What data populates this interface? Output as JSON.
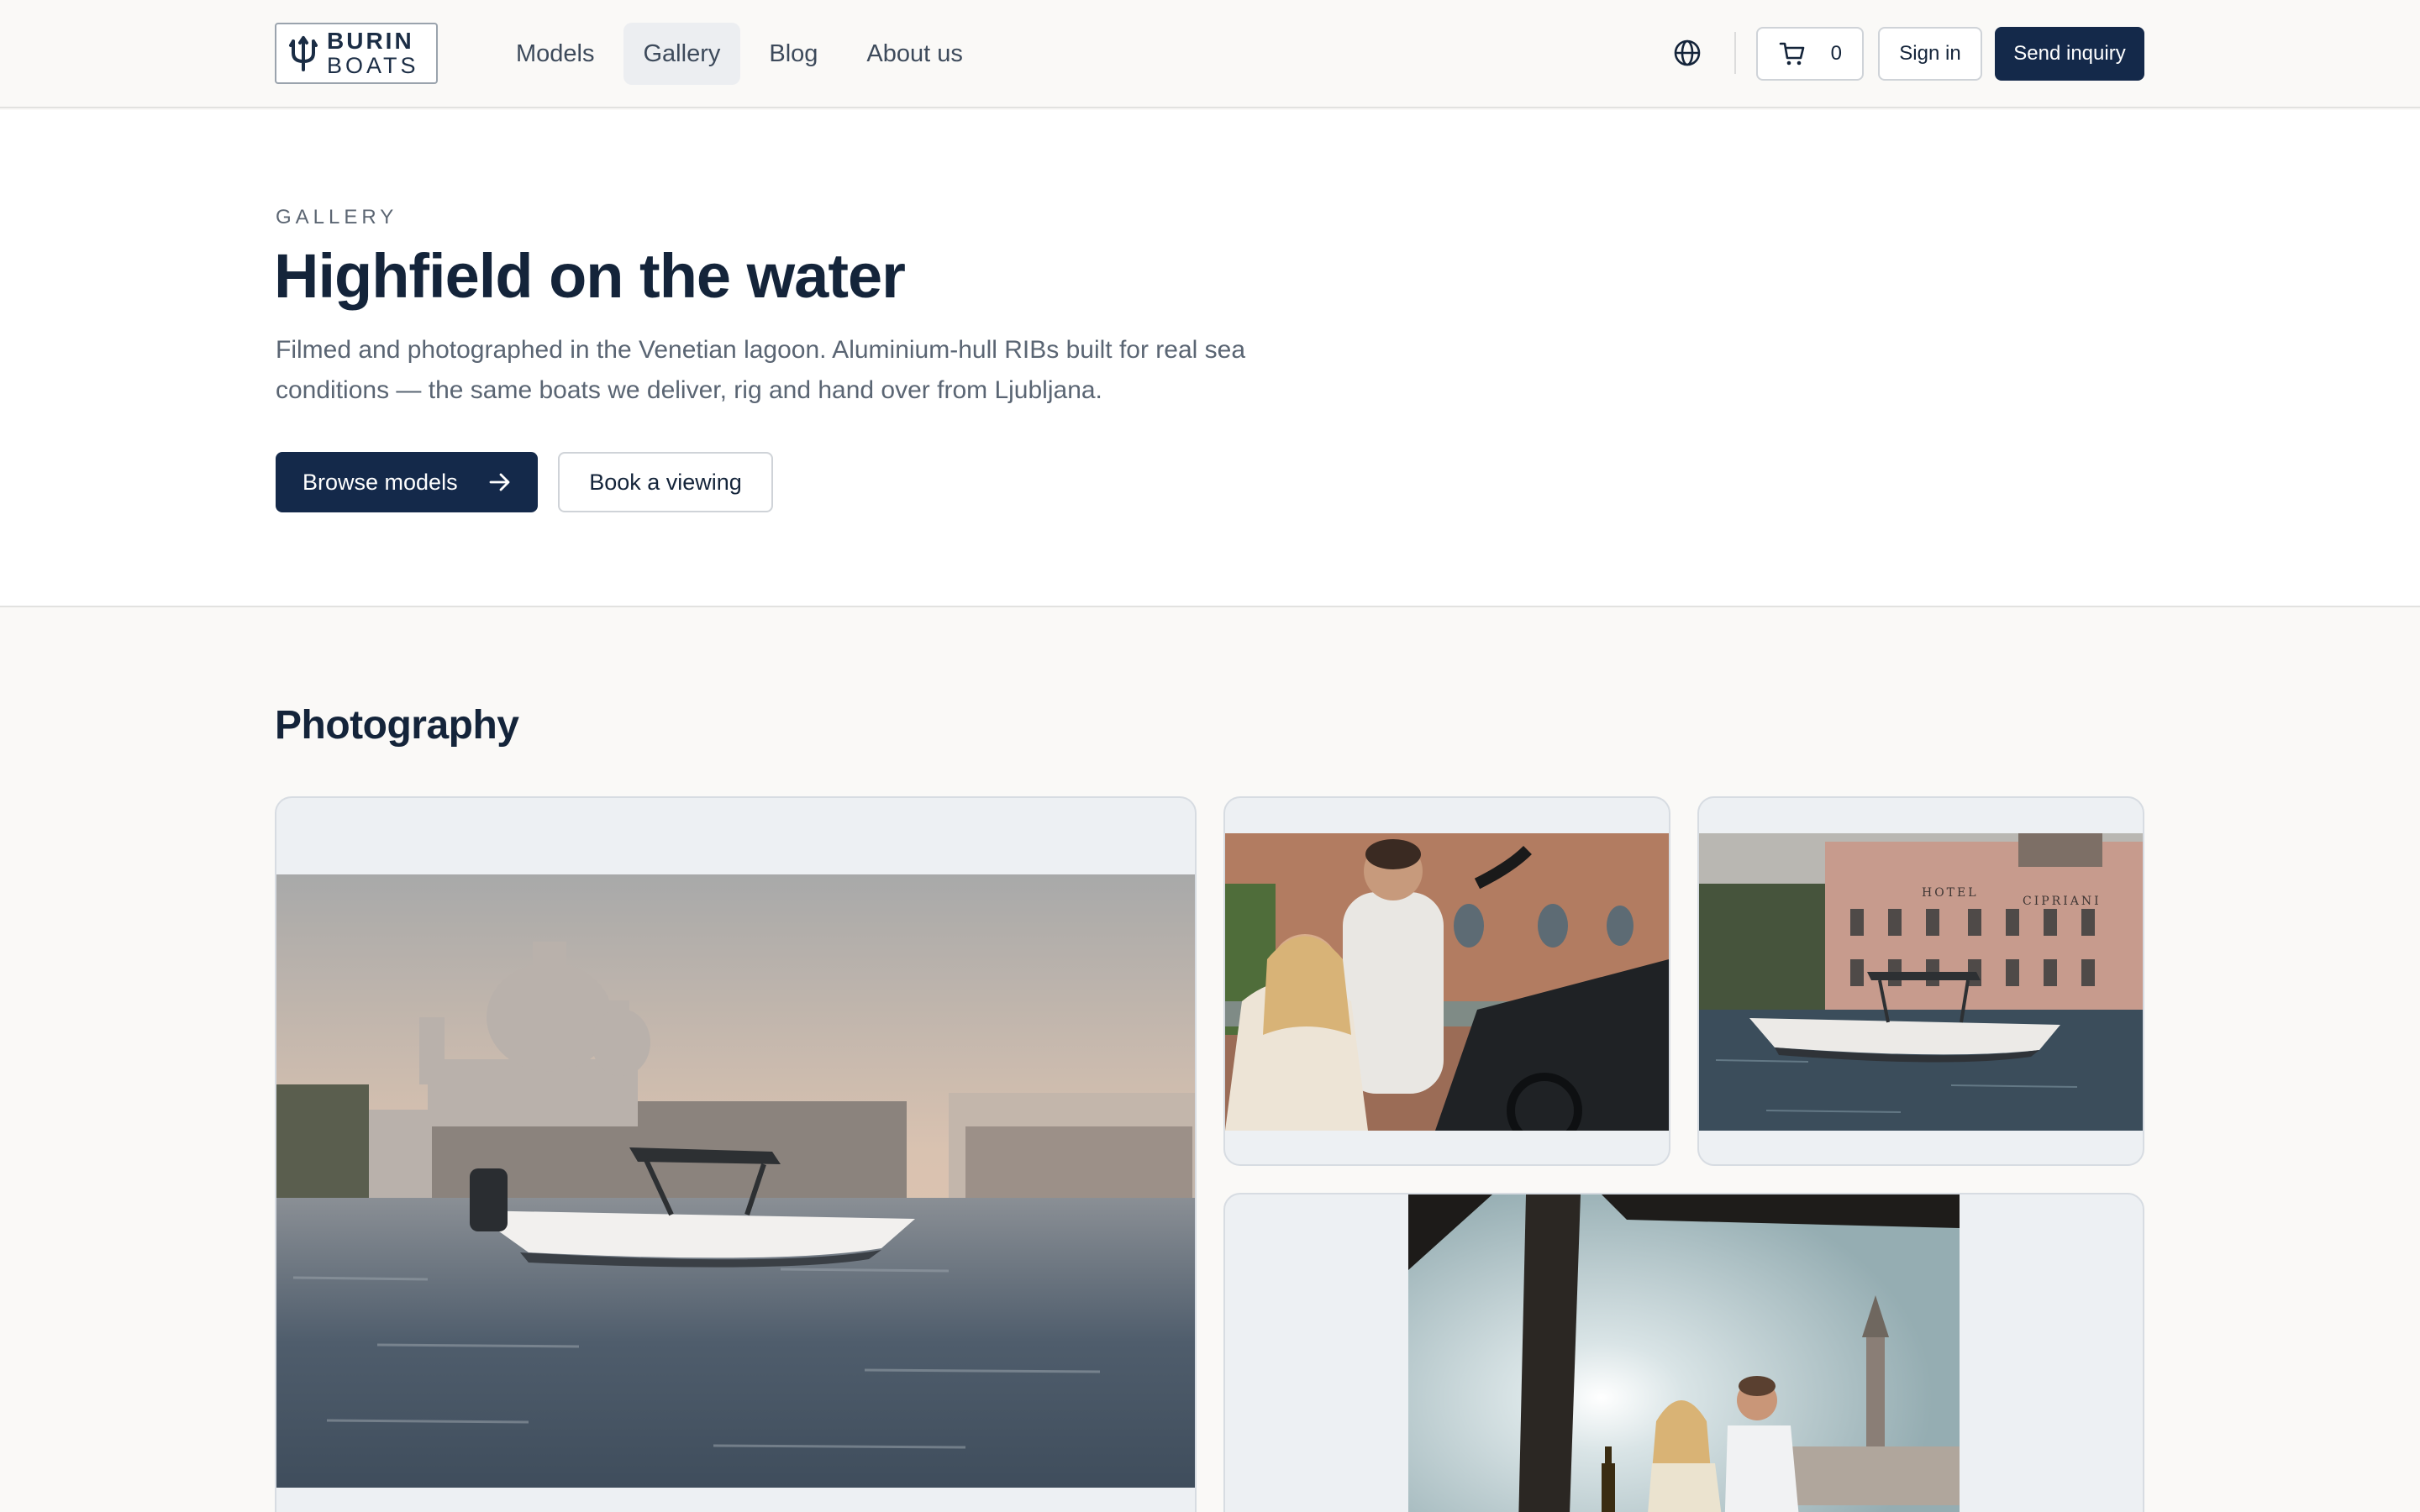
{
  "header": {
    "logo": {
      "word1": "BURIN",
      "word2": "BOATS"
    },
    "nav": [
      {
        "label": "Models",
        "active": false
      },
      {
        "label": "Gallery",
        "active": true
      },
      {
        "label": "Blog",
        "active": false
      },
      {
        "label": "About us",
        "active": false
      }
    ],
    "language_icon": "globe-icon",
    "cart": {
      "icon": "cart-icon",
      "count": "0"
    },
    "sign_in_label": "Sign in",
    "send_inquiry_label": "Send inquiry"
  },
  "hero": {
    "eyebrow": "GALLERY",
    "title": "Highfield on the water",
    "description": "Filmed and photographed in the Venetian lagoon. Aluminium-hull RIBs built for real sea conditions — the same boats we deliver, rig and hand over from Ljubljana.",
    "browse_label": "Browse models",
    "browse_icon": "arrow-right-icon",
    "viewing_label": "Book a viewing"
  },
  "photography": {
    "title": "Photography",
    "hotel_sign_left": "HOTEL",
    "hotel_sign_right": "CIPRIANI"
  },
  "colors": {
    "navy": "#14294a",
    "page_bg": "#faf9f7",
    "card_bg": "#edf0f3",
    "text_muted": "#5a6573"
  }
}
